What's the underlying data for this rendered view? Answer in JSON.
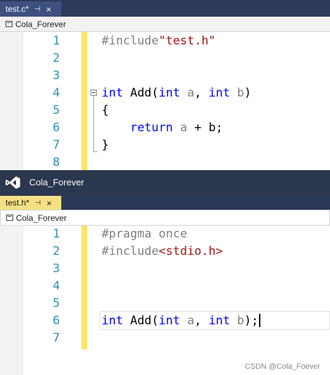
{
  "top_editor": {
    "tab": {
      "label": "test.c*",
      "pin_glyph": "⊣",
      "close_glyph": "×"
    },
    "nav_project": "Cola_Forever",
    "lines": [
      {
        "num": "1",
        "pp": "#include",
        "str": "\"test.h\""
      },
      {
        "num": "2"
      },
      {
        "num": "3"
      },
      {
        "num": "4",
        "kw1": "int",
        "name": " Add(",
        "kw2": "int",
        "p1": " a",
        "sep": ", ",
        "kw3": "int",
        "p2": " b",
        "end": ")"
      },
      {
        "num": "5",
        "text": "{"
      },
      {
        "num": "6",
        "indent": "    ",
        "kw": "return",
        "rest_a": " a",
        "rest_op": " + ",
        "rest_b": "b",
        "semi": ";"
      },
      {
        "num": "7",
        "text": "}"
      },
      {
        "num": "8"
      }
    ]
  },
  "window_title": "Cola_Forever",
  "bottom_editor": {
    "tab": {
      "label": "test.h*",
      "pin_glyph": "⊣",
      "close_glyph": "×"
    },
    "nav_project": "Cola_Forever",
    "lines": [
      {
        "num": "1",
        "pp": "#pragma once"
      },
      {
        "num": "2",
        "pp": "#include",
        "str": "<stdio.h>"
      },
      {
        "num": "3"
      },
      {
        "num": "4"
      },
      {
        "num": "5"
      },
      {
        "num": "6",
        "kw1": "int",
        "name": " Add(",
        "kw2": "int",
        "p1": " a",
        "sep": ", ",
        "kw3": "int",
        "p2": " b",
        "end": ");"
      },
      {
        "num": "7"
      }
    ]
  },
  "watermark": "CSDN @Cola_Foever",
  "colors": {
    "keyword": "#0000ff",
    "preprocessor": "#808080",
    "string": "#a31515",
    "line_number": "#2b91af",
    "changed_bar": "#fce36a"
  }
}
